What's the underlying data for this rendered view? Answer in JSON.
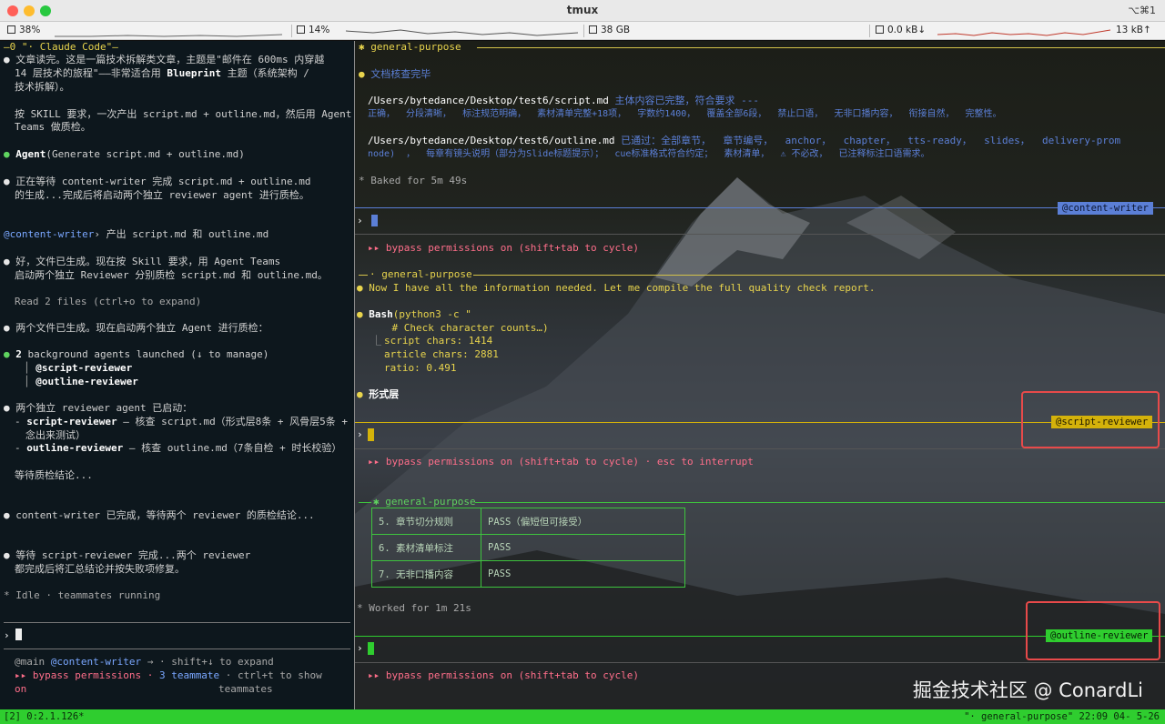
{
  "window": {
    "title": "tmux",
    "shortcut": "⌥⌘1"
  },
  "stats": {
    "cpu": "38%",
    "gpu": "14%",
    "memory": "38 GB",
    "net_down": "0.0 kB↓",
    "net_up": "13 kB↑"
  },
  "left": {
    "header": "—0 \"· Claude Code\"—",
    "m1a": "文章读完。这是一篇技术拆解类文章，主题是\"邮件在 600ms 内穿越",
    "m1b": "14 层技术的旅程\"——非常适合用 ",
    "m1b_bold": "Blueprint",
    "m1b_end": " 主题（系统架构 /",
    "m1c": "技术拆解）。",
    "m2a": "按 SKILL 要求，一次产出 script.md + outline.md，然后用 Agent",
    "m2b": "Teams 做质检。",
    "agent_bold": "Agent",
    "agent_rest": "(Generate script.md + outline.md)",
    "m3a": "正在等待 content-writer 完成 script.md + outline.md",
    "m3b": "的生成...完成后将启动两个独立 reviewer agent 进行质检。",
    "cw_tag": "@content-writer",
    "cw_msg": "› 产出 script.md 和 outline.md",
    "m4a": "好，文件已生成。现在按 Skill 要求，用 Agent Teams",
    "m4b": "启动两个独立 Reviewer 分别质检 script.md 和 outline.md。",
    "read_files": "Read 2 files (ctrl+o to expand)",
    "m5": "两个文件已生成。现在启动两个独立 Agent 进行质检：",
    "bg_bold": "2",
    "bg_rest": " background agents launched (↓ to manage)",
    "bg_agent1": "@script-reviewer",
    "bg_agent2": "@outline-reviewer",
    "m6": "两个独立 reviewer agent 已启动：",
    "m6_l1_bold": "script-reviewer",
    "m6_l1_rest": " — 核查 script.md（形式层8条 + 风骨层5条 +",
    "m6_l1_cont": "念出来测试）",
    "m6_l2_bold": "outline-reviewer",
    "m6_l2_rest": " — 核查 outline.md（7条自检 + 时长校验）",
    "m6_wait": "等待质检结论...",
    "m7": "content-writer 已完成，等待两个 reviewer 的质检结论...",
    "m8a": "等待 script-reviewer 完成...两个 reviewer",
    "m8b": "都完成后将汇总结论并按失败项修复。",
    "idle": "* Idle · teammates running",
    "prompt": "›",
    "f1_main": "@main ",
    "f1_cw": "@content-writer",
    "f1_rest": " → · shift+↓ to expand",
    "f2_bypass": "▸▸ bypass permissions · ",
    "f2_count": "3 teammate",
    "f2_rest": " · ctrl+t to show",
    "f3_on": "on",
    "f3_teammates": "teammates"
  },
  "right": {
    "section1": "✱ general-purpose",
    "s1_title": "文档核查完毕",
    "s1_path1": "/Users/bytedance/Desktop/test6/script.md",
    "s1_path1_note": " 主体内容已完整，符合要求 ---",
    "s1_row1": "正确，  分段清晰，  标注规范明确，  素材清单完整+18项，  字数约1400，  覆盖全部6段，  禁止口语，  无非口播内容，  衔接自然，  完整性。",
    "s1_path2": "/Users/bytedance/Desktop/test6/outline.md",
    "s1_path2_note": " 已通过：全部章节，  章节编号，  anchor，  chapter，  tts-ready，  slides，  delivery-prom",
    "s1_row2": "node)  ，  每章有镜头说明（部分为Slide标题提示）；  cue标准格式符合约定；  素材清单，  ⚠ 不必改，  已注释标注口语需求。",
    "baked": "* Baked for 5m 49s",
    "badge_cw": "@content-writer",
    "bypass1": "▸▸ bypass permissions on (shift+tab to cycle)",
    "section2": "· general-purpose",
    "s2_msg": "Now I have all the information needed. Let me compile the full quality check report.",
    "bash_bold": "Bash",
    "bash_rest": "(python3 -c \"",
    "bash_cmt": "    # Check character counts…)",
    "bash_o1": "script chars: 1414",
    "bash_o2": "article chars: 2881",
    "bash_o3": "ratio: 0.491",
    "form_layer": "形式层",
    "badge_sr": "@script-reviewer",
    "bypass2": "▸▸ bypass permissions on (shift+tab to cycle) · esc to interrupt",
    "section3": "✱ general-purpose",
    "table": [
      {
        "item": "5. 章节切分规则",
        "result": "PASS（偏短但可接受）"
      },
      {
        "item": "6. 素材清单标注",
        "result": "PASS"
      },
      {
        "item": "7. 无非口播内容",
        "result": "PASS"
      }
    ],
    "worked": "* Worked for 1m 21s",
    "badge_or": "@outline-reviewer",
    "bypass3": "▸▸ bypass permissions on (shift+tab to cycle)"
  },
  "status": {
    "left": "[2] 0:2.1.126*",
    "right": "\"· general-purpose\" 22:09 04- 5-26"
  },
  "watermark": "掘金技术社区 @ ConardLi",
  "colors": {
    "blue_accent": "#5b7fd6",
    "yellow_accent": "#d4b20a",
    "green_accent": "#2fcd2f",
    "highlight_red": "#e84a4a"
  }
}
